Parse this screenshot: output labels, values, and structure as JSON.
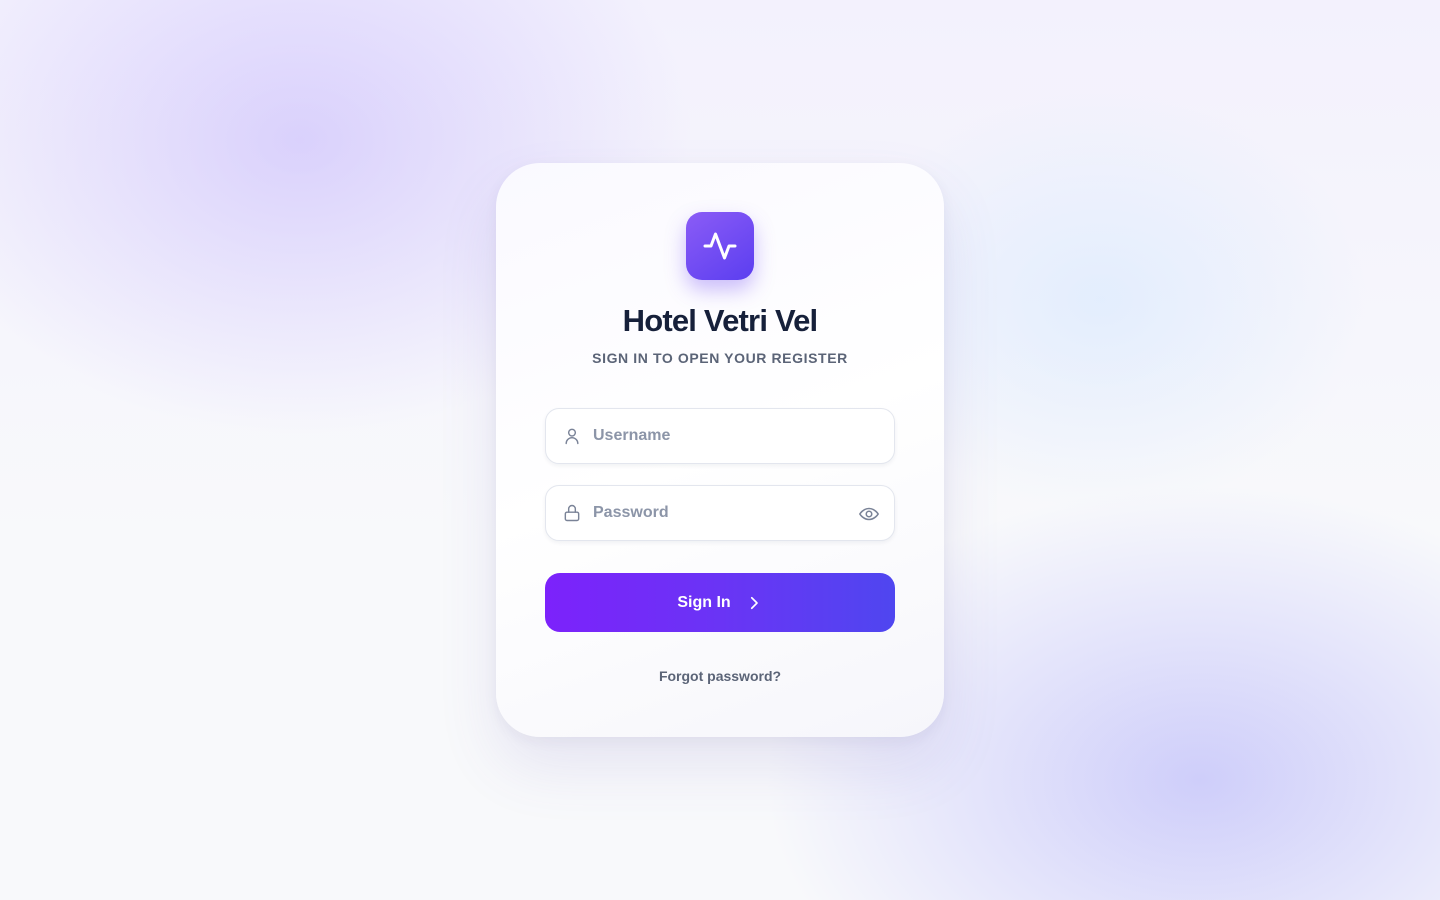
{
  "app": {
    "title": "Hotel Vetri Vel",
    "subtitle": "SIGN IN TO OPEN YOUR REGISTER",
    "logo_icon": "pulse-icon"
  },
  "form": {
    "username": {
      "placeholder": "Username",
      "value": "",
      "icon": "user-icon"
    },
    "password": {
      "placeholder": "Password",
      "value": "",
      "icon": "lock-icon",
      "toggle_icon": "eye-icon"
    },
    "submit_label": "Sign In",
    "submit_icon": "chevron-right-icon",
    "forgot_label": "Forgot password?"
  },
  "colors": {
    "accent_start": "#7c22fb",
    "accent_end": "#4f46f0",
    "title": "#16203a",
    "muted": "#5b6477",
    "placeholder": "#8c95a8"
  }
}
